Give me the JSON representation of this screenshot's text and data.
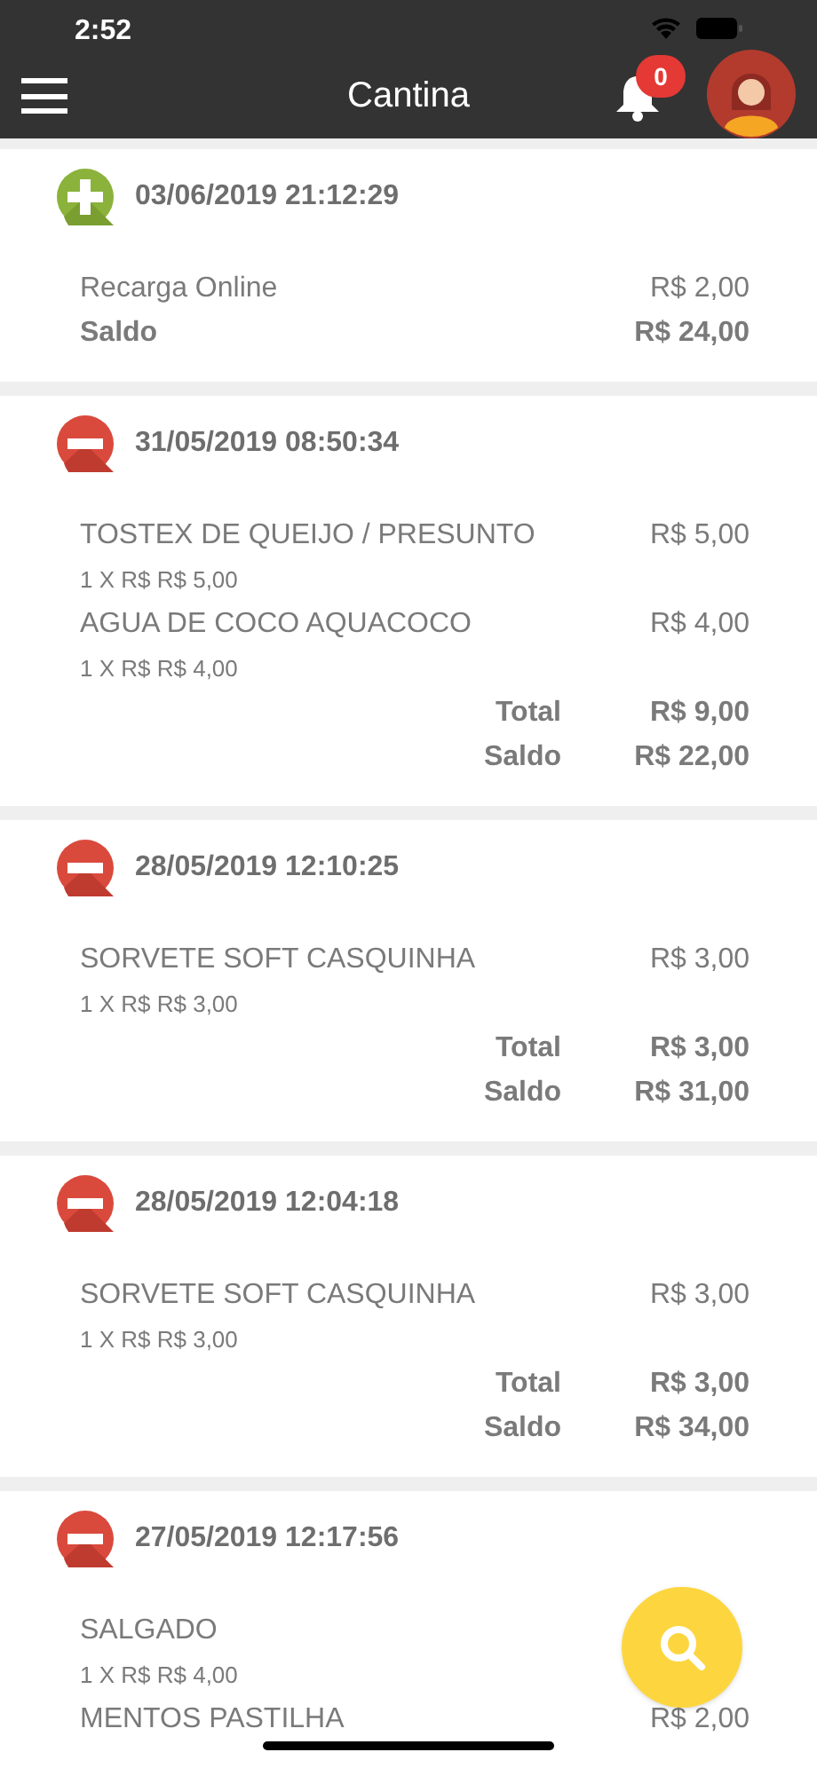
{
  "status_bar": {
    "time": "2:52"
  },
  "header": {
    "title": "Cantina",
    "notifications": {
      "count": "0"
    }
  },
  "transactions": [
    {
      "kind": "credit",
      "date": "03/06/2019 21:12:29",
      "lines": [
        {
          "kind": "item",
          "name": "Recarga Online",
          "amount": "R$ 2,00"
        },
        {
          "kind": "summary",
          "label": "Saldo",
          "amount": "R$ 24,00"
        }
      ]
    },
    {
      "kind": "debit",
      "date": "31/05/2019 08:50:34",
      "lines": [
        {
          "kind": "item",
          "name": "TOSTEX DE QUEIJO / PRESUNTO",
          "amount": "R$ 5,00"
        },
        {
          "kind": "detail",
          "text": "1 X R$ R$ 5,00"
        },
        {
          "kind": "item",
          "name": "AGUA DE COCO AQUACOCO",
          "amount": "R$ 4,00"
        },
        {
          "kind": "detail",
          "text": "1 X R$ R$ 4,00"
        },
        {
          "kind": "total",
          "label": "Total",
          "amount": "R$ 9,00"
        },
        {
          "kind": "total",
          "label": "Saldo",
          "amount": "R$ 22,00"
        }
      ]
    },
    {
      "kind": "debit",
      "date": "28/05/2019 12:10:25",
      "lines": [
        {
          "kind": "item",
          "name": "SORVETE SOFT CASQUINHA",
          "amount": "R$ 3,00"
        },
        {
          "kind": "detail",
          "text": "1 X R$ R$ 3,00"
        },
        {
          "kind": "total",
          "label": "Total",
          "amount": "R$ 3,00"
        },
        {
          "kind": "total",
          "label": "Saldo",
          "amount": "R$ 31,00"
        }
      ]
    },
    {
      "kind": "debit",
      "date": "28/05/2019 12:04:18",
      "lines": [
        {
          "kind": "item",
          "name": "SORVETE SOFT CASQUINHA",
          "amount": "R$ 3,00"
        },
        {
          "kind": "detail",
          "text": "1 X R$ R$ 3,00"
        },
        {
          "kind": "total",
          "label": "Total",
          "amount": "R$ 3,00"
        },
        {
          "kind": "total",
          "label": "Saldo",
          "amount": "R$ 34,00"
        }
      ]
    },
    {
      "kind": "debit",
      "date": "27/05/2019 12:17:56",
      "lines": [
        {
          "kind": "item",
          "name": "SALGADO"
        },
        {
          "kind": "detail",
          "text": "1 X R$ R$ 4,00"
        },
        {
          "kind": "item",
          "name": "MENTOS PASTILHA",
          "amount": "R$ 2,00"
        }
      ]
    }
  ]
}
